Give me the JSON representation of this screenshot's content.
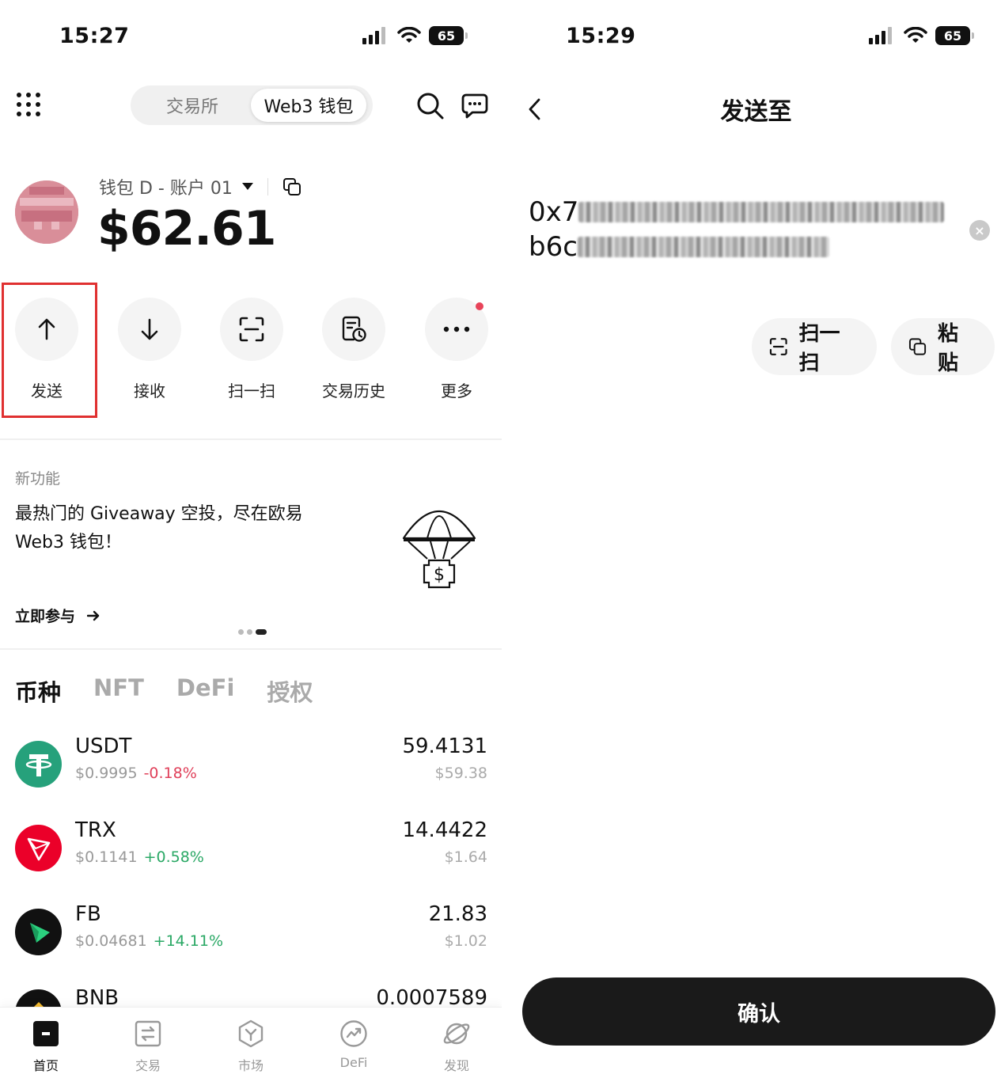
{
  "left": {
    "status": {
      "time": "15:27",
      "battery": "65"
    },
    "header": {
      "segment_inactive": "交易所",
      "segment_active": "Web3 钱包"
    },
    "account": {
      "name": "钱包 D - 账户 01",
      "balance": "$62.61"
    },
    "actions": [
      {
        "label": "发送",
        "icon": "arrow-up-icon"
      },
      {
        "label": "接收",
        "icon": "arrow-down-icon"
      },
      {
        "label": "扫一扫",
        "icon": "scan-icon"
      },
      {
        "label": "交易历史",
        "icon": "history-icon"
      },
      {
        "label": "更多",
        "icon": "more-icon"
      }
    ],
    "promo": {
      "tag": "新功能",
      "title": "最热门的 Giveaway 空投，尽在欧易 Web3 钱包！",
      "link": "立即参与"
    },
    "tabs": [
      "币种",
      "NFT",
      "DeFi",
      "授权"
    ],
    "assets": [
      {
        "symbol": "USDT",
        "price": "$0.9995",
        "change": "-0.18%",
        "amount": "59.4131",
        "value": "$59.38"
      },
      {
        "symbol": "TRX",
        "price": "$0.1141",
        "change": "+0.58%",
        "amount": "14.4422",
        "value": "$1.64"
      },
      {
        "symbol": "FB",
        "price": "$0.04681",
        "change": "+14.11%",
        "amount": "21.83",
        "value": "$1.02"
      },
      {
        "symbol": "BNB",
        "amount": "0.0007589"
      }
    ],
    "nav": [
      "首页",
      "交易",
      "市场",
      "DeFi",
      "发现"
    ]
  },
  "right": {
    "status": {
      "time": "15:29",
      "battery": "65"
    },
    "title": "发送至",
    "address_line1_prefix": "0x7",
    "address_line2_prefix": "b6c",
    "scan_label": "扫一扫",
    "paste_label": "粘贴",
    "confirm_label": "确认"
  },
  "colors": {
    "negative": "#e0405a",
    "positive": "#2aa865",
    "highlight": "#e03030",
    "usdt": "#26a17b",
    "trx": "#eb0029",
    "bnb": "#f3ba2f"
  }
}
